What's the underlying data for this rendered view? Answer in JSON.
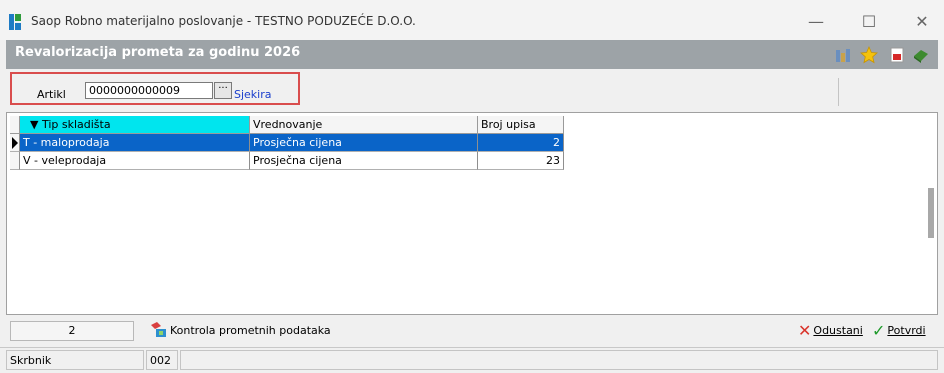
{
  "window": {
    "title": "Saop Robno materijalno poslovanje - TESTNO PODUZEĆE D.O.O.",
    "minimize": "—",
    "maximize": "☐",
    "close": "✕"
  },
  "form": {
    "title": "Revalorizacija prometa za godinu 2026"
  },
  "filter": {
    "artikl_label": "Artikl",
    "artikl_value": "0000000000009",
    "browse_label": "···",
    "artikl_name": "Sjekira"
  },
  "table": {
    "headers": [
      "▼ Tip skladišta",
      "Vrednovanje",
      "Broj upisa"
    ],
    "rows": [
      {
        "tip": "T - maloprodaja",
        "vrednovanje": "Prosječna cijena",
        "broj": "2"
      },
      {
        "tip": "V - veleprodaja",
        "vrednovanje": "Prosječna cijena",
        "broj": "23"
      }
    ]
  },
  "footer": {
    "count": "2",
    "kontrola_label": "Kontrola prometnih podataka",
    "odustani_label": "Odustani",
    "potvrdi_label": "Potvrdi"
  },
  "status": {
    "user": "Skrbnik",
    "code": "002"
  },
  "colors": {
    "selection": "#0a64c8",
    "active_header": "#00e5ee",
    "highlight_border": "#d94d4d",
    "link": "#1a3ecc"
  }
}
